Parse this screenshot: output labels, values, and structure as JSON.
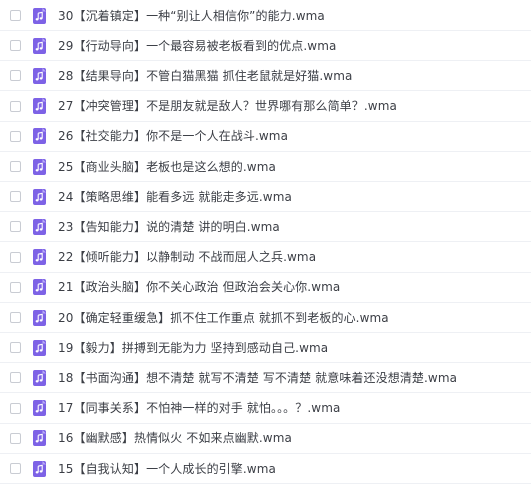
{
  "file_icon": "audio-file-icon",
  "accent_color": "#7d62e6",
  "files": [
    {
      "name": "30【沉着镇定】一种“别让人相信你”的能力.wma"
    },
    {
      "name": "29【行动导向】一个最容易被老板看到的优点.wma"
    },
    {
      "name": "28【结果导向】不管白猫黑猫 抓住老鼠就是好猫.wma"
    },
    {
      "name": "27【冲突管理】不是朋友就是敌人？世界哪有那么简单？.wma"
    },
    {
      "name": "26【社交能力】你不是一个人在战斗.wma"
    },
    {
      "name": "25【商业头脑】老板也是这么想的.wma"
    },
    {
      "name": "24【策略思维】能看多远 就能走多远.wma"
    },
    {
      "name": "23【告知能力】说的清楚 讲的明白.wma"
    },
    {
      "name": "22【倾听能力】以静制动 不战而屈人之兵.wma"
    },
    {
      "name": "21【政治头脑】你不关心政治 但政治会关心你.wma"
    },
    {
      "name": "20【确定轻重缓急】抓不住工作重点 就抓不到老板的心.wma"
    },
    {
      "name": "19【毅力】拼搏到无能为力 坚持到感动自己.wma"
    },
    {
      "name": "18【书面沟通】想不清楚 就写不清楚 写不清楚 就意味着还没想清楚.wma"
    },
    {
      "name": "17【同事关系】不怕神一样的对手 就怕。。。？.wma"
    },
    {
      "name": "16【幽默感】热情似火 不如来点幽默.wma"
    },
    {
      "name": "15【自我认知】一个人成长的引擎.wma"
    }
  ]
}
